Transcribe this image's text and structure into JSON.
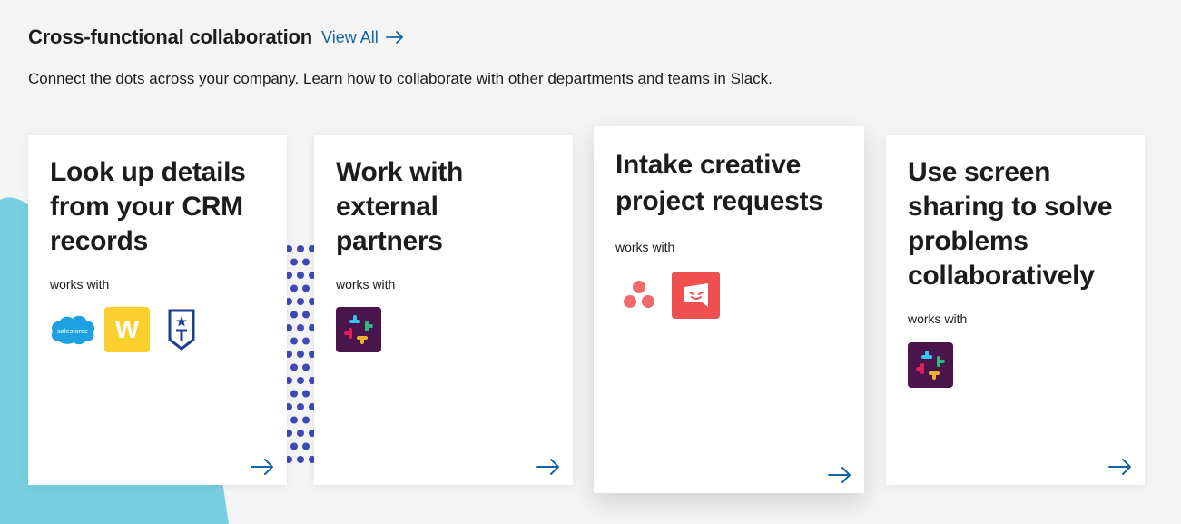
{
  "section": {
    "title": "Cross-functional collaboration",
    "view_all_label": "View All",
    "description": "Connect the dots across your company. Learn how to collaborate with other departments and teams in Slack."
  },
  "cards": [
    {
      "title": "Look up details from your CRM records",
      "works_with": "works with",
      "logos": [
        "salesforce-logo",
        "workato-logo",
        "troops-logo"
      ],
      "logo_text": [
        "salesforce",
        "W"
      ]
    },
    {
      "title": "Work with external partners",
      "works_with": "works with",
      "logos": [
        "slack-logo"
      ]
    },
    {
      "title": "Intake creative project requests",
      "works_with": "works with",
      "logos": [
        "asana-logo",
        "workfront-logo"
      ]
    },
    {
      "title": "Use screen sharing to solve problems collaboratively",
      "works_with": "works with",
      "logos": [
        "slack-logo"
      ]
    }
  ],
  "colors": {
    "link": "#1264a3",
    "background": "#f4f4f4",
    "blob": "#78cfe0",
    "dots": "#3f49b5",
    "slack_bg": "#4a154b",
    "workato": "#fbd02e",
    "salesforce": "#1ea1e0",
    "troops": "#1c3f94",
    "workfront": "#ef4f4f",
    "asana": "#f06a6a"
  },
  "icons": [
    "arrow-right-icon"
  ]
}
